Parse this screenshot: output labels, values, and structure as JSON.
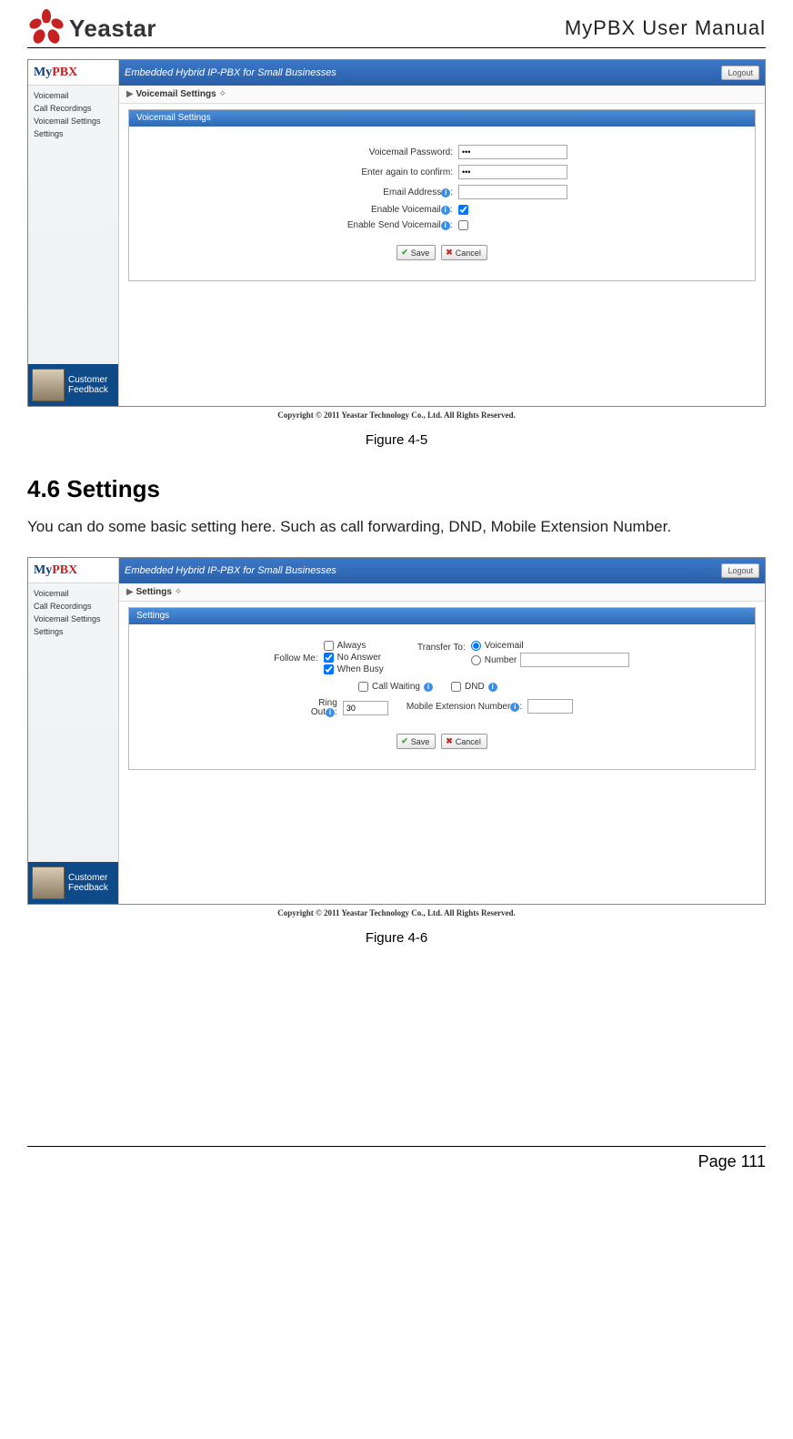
{
  "header": {
    "brand": "Yeastar",
    "doc_title": "MyPBX User Manual"
  },
  "shot1": {
    "app_logo_a": "My",
    "app_logo_b": "PBX",
    "banner": "Embedded Hybrid IP-PBX for Small Businesses",
    "logout": "Logout",
    "breadcrumb_prefix": "▶",
    "breadcrumb": "Voicemail Settings",
    "breadcrumb_suffix": "✧",
    "panel_title": "Voicemail Settings",
    "sidebar": {
      "items": [
        "Voicemail",
        "Call Recordings",
        "Voicemail Settings",
        "Settings"
      ],
      "feedback_l1": "Customer",
      "feedback_l2": "Feedback"
    },
    "fields": {
      "password_label": "Voicemail Password:",
      "password_value": "•••",
      "confirm_label": "Enter again to confirm:",
      "confirm_value": "•••",
      "email_label": "Email Address",
      "email_value": "",
      "enable_vm_label": "Enable Voicemail",
      "enable_send_label": "Enable Send Voicemail"
    },
    "buttons": {
      "save": "Save",
      "cancel": "Cancel"
    },
    "copyright": "Copyright © 2011 Yeastar Technology Co., Ltd. All Rights Reserved."
  },
  "fig1_caption": "Figure 4-5",
  "section": {
    "title": "4.6 Settings",
    "text": "You can do some basic setting here. Such as call forwarding, DND, Mobile Extension Number."
  },
  "shot2": {
    "app_logo_a": "My",
    "app_logo_b": "PBX",
    "banner": "Embedded Hybrid IP-PBX for Small Businesses",
    "logout": "Logout",
    "breadcrumb_prefix": "▶",
    "breadcrumb": "Settings",
    "breadcrumb_suffix": "✧",
    "panel_title": "Settings",
    "sidebar": {
      "items": [
        "Voicemail",
        "Call Recordings",
        "Voicemail Settings",
        "Settings"
      ],
      "feedback_l1": "Customer",
      "feedback_l2": "Feedback"
    },
    "followme": {
      "label": "Follow Me:",
      "opt_always": "Always",
      "opt_noanswer": "No Answer",
      "opt_busy": "When Busy"
    },
    "transfer": {
      "label": "Transfer To:",
      "opt_vm": "Voicemail",
      "opt_number": "Number",
      "number_value": ""
    },
    "callwaiting_label": "Call Waiting",
    "dnd_label": "DND",
    "ringout_label_l1": "Ring",
    "ringout_label_l2": "Out",
    "ringout_value": "30",
    "mobile_ext_label": "Mobile Extension Number",
    "mobile_ext_value": "",
    "buttons": {
      "save": "Save",
      "cancel": "Cancel"
    },
    "copyright": "Copyright © 2011 Yeastar Technology Co., Ltd. All Rights Reserved."
  },
  "fig2_caption": "Figure 4-6",
  "footer": {
    "page": "Page 111"
  }
}
